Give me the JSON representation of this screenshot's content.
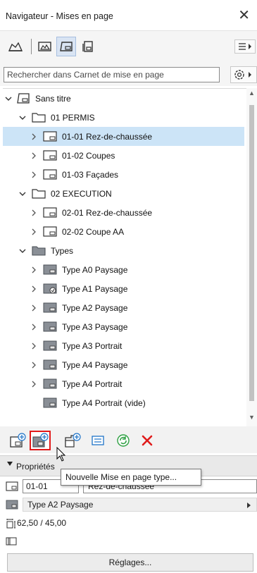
{
  "window": {
    "title": "Navigateur - Mises en page",
    "close_glyph": "✕"
  },
  "search": {
    "placeholder": "Rechercher dans Carnet de mise en page"
  },
  "tree": {
    "items": [
      {
        "label": "Sans titre",
        "icon": "layout-book-icon",
        "expanded": true
      },
      {
        "label": "01 PERMIS",
        "icon": "folder-icon",
        "expanded": true
      },
      {
        "label": "01-01 Rez-de-chaussée",
        "icon": "layout-sheet-icon",
        "selected": true
      },
      {
        "label": "01-02 Coupes",
        "icon": "layout-sheet-icon"
      },
      {
        "label": "01-03 Façades",
        "icon": "layout-sheet-icon"
      },
      {
        "label": "02 EXECUTION",
        "icon": "folder-icon",
        "expanded": true
      },
      {
        "label": "02-01 Rez-de-chaussée",
        "icon": "layout-sheet-icon"
      },
      {
        "label": "02-02 Coupe AA",
        "icon": "layout-sheet-icon"
      },
      {
        "label": "Types",
        "icon": "folder-gray-icon",
        "expanded": true
      },
      {
        "label": "Type A0 Paysage",
        "icon": "master-layout-icon"
      },
      {
        "label": "Type A1 Paysage",
        "icon": "master-layout-linked-icon"
      },
      {
        "label": "Type A2 Paysage",
        "icon": "master-layout-icon"
      },
      {
        "label": "Type A3 Paysage",
        "icon": "master-layout-icon"
      },
      {
        "label": "Type A3 Portrait",
        "icon": "master-layout-icon"
      },
      {
        "label": "Type A4 Paysage",
        "icon": "master-layout-icon"
      },
      {
        "label": "Type A4 Portrait",
        "icon": "master-layout-icon"
      },
      {
        "label": "Type A4 Portrait (vide)",
        "icon": "master-layout-icon"
      }
    ]
  },
  "tooltip": {
    "text": "Nouvelle Mise en page type..."
  },
  "properties": {
    "header": "Propriétés",
    "id_value": "01-01",
    "name_value": "Rez-de-chaussée",
    "master_value": "Type A2 Paysage",
    "size_value": "62,50 / 45,00"
  },
  "settings_button": "Réglages...",
  "colors": {
    "selected_row": "#cce4f7",
    "highlight_border": "#e21a1a",
    "delete_red": "#e01b1b",
    "refresh_green": "#2ea043",
    "accent_blue": "#1e73c8"
  }
}
